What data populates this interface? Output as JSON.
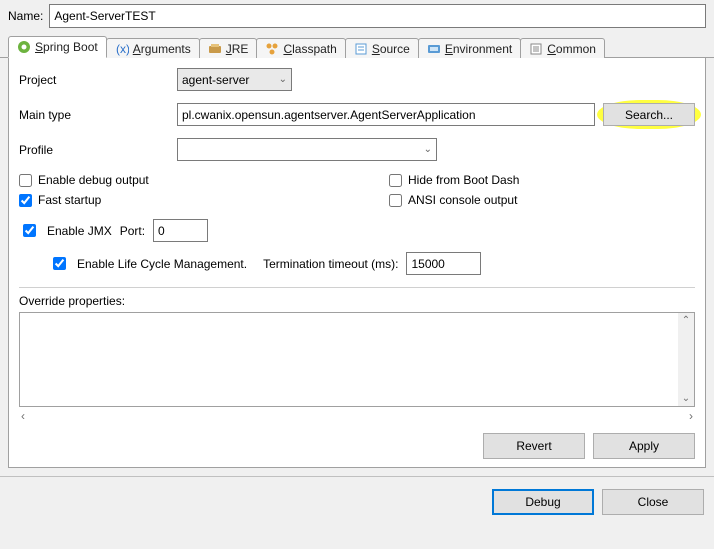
{
  "name_label": "Name:",
  "name_value": "Agent-ServerTEST",
  "tabs": [
    {
      "label": "Spring Boot",
      "mn": "S"
    },
    {
      "label": "Arguments",
      "mn": "A"
    },
    {
      "label": "JRE",
      "mn": "J"
    },
    {
      "label": "Classpath",
      "mn": "C"
    },
    {
      "label": "Source",
      "mn": "S"
    },
    {
      "label": "Environment",
      "mn": "E"
    },
    {
      "label": "Common",
      "mn": "C"
    }
  ],
  "fields": {
    "project_label": "Project",
    "project_value": "agent-server",
    "main_type_label": "Main type",
    "main_type_value": "pl.cwanix.opensun.agentserver.AgentServerApplication",
    "search_label": "Search...",
    "profile_label": "Profile"
  },
  "checks": {
    "enable_debug": "Enable debug output",
    "fast_startup": "Fast startup",
    "hide_boot_dash": "Hide from Boot Dash",
    "ansi_console": "ANSI console output",
    "enable_jmx": "Enable JMX",
    "port_label": "Port:",
    "port_value": "0",
    "enable_lcm": "Enable Life Cycle Management.",
    "term_label": "Termination timeout (ms):",
    "term_value": "15000"
  },
  "override_label": "Override properties:",
  "buttons": {
    "revert": "Revert",
    "apply": "Apply",
    "debug": "Debug",
    "close": "Close"
  }
}
